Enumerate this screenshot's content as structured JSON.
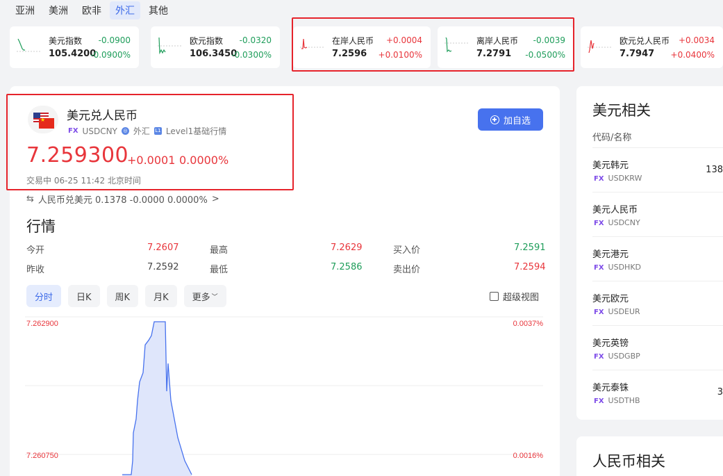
{
  "region_tabs": [
    "亚洲",
    "美洲",
    "欧非",
    "外汇",
    "其他"
  ],
  "active_region": "外汇",
  "tickers": [
    {
      "name": "美元指数",
      "price": "105.4200",
      "change": "-0.0900",
      "pct": "-0.0900%",
      "dir": "down"
    },
    {
      "name": "欧元指数",
      "price": "106.3450",
      "change": "-0.0320",
      "pct": "-0.0300%",
      "dir": "down"
    },
    {
      "name": "在岸人民币",
      "price": "7.2596",
      "change": "+0.0004",
      "pct": "+0.0100%",
      "dir": "up"
    },
    {
      "name": "离岸人民币",
      "price": "7.2791",
      "change": "-0.0039",
      "pct": "-0.0500%",
      "dir": "down"
    },
    {
      "name": "欧元兑人民币",
      "price": "7.7947",
      "change": "+0.0034",
      "pct": "+0.0400%",
      "dir": "up"
    }
  ],
  "instrument": {
    "title": "美元兑人民币",
    "fx_tag": "FX",
    "code": "USDCNY",
    "category": "外汇",
    "level_badge": "L1",
    "level": "Level1基础行情",
    "price": "7.259300",
    "change": "+0.0001",
    "change_pct": "0.0000%",
    "status": "交易中 06-25 11:42 北京时间",
    "add_button": "加自选",
    "inverse": "人民币兑美元 0.1378 -0.0000 0.0000%",
    "inverse_arrow": ">"
  },
  "market": {
    "title": "行情",
    "stats": [
      {
        "label": "今开",
        "value": "7.2607",
        "dir": "up"
      },
      {
        "label": "最高",
        "value": "7.2629",
        "dir": "up"
      },
      {
        "label": "买入价",
        "value": "7.2591",
        "dir": "down"
      },
      {
        "label": "昨收",
        "value": "7.2592",
        "dir": "flat"
      },
      {
        "label": "最低",
        "value": "7.2586",
        "dir": "down"
      },
      {
        "label": "卖出价",
        "value": "7.2594",
        "dir": "up"
      }
    ]
  },
  "period_tabs": [
    "分时",
    "日K",
    "周K",
    "月K",
    "更多"
  ],
  "active_period": "分时",
  "super_view": "超级视图",
  "chart_data": {
    "type": "area",
    "y_left_ticks": [
      "7.262900",
      "7.260750"
    ],
    "y_right_ticks": [
      "0.0037%",
      "0.0016%"
    ],
    "ylim": [
      7.2596,
      7.2629
    ],
    "x": [
      0,
      13,
      15,
      16,
      20,
      22,
      25,
      30,
      33,
      38,
      42,
      46,
      52,
      54,
      58,
      60,
      62,
      64,
      66,
      70,
      80,
      90,
      100
    ],
    "values": [
      7.2596,
      7.2596,
      7.2599,
      7.2605,
      7.2608,
      7.2612,
      7.2616,
      7.2618,
      7.2624,
      7.2625,
      7.2626,
      7.2629,
      7.2629,
      7.2629,
      7.2629,
      7.2629,
      7.2629,
      7.2614,
      7.262,
      7.2612,
      7.2604,
      7.2599,
      7.2596
    ],
    "grid": true
  },
  "usd_related": {
    "title": "美元相关",
    "column": "代码/名称",
    "items": [
      {
        "name": "美元韩元",
        "tag": "FX",
        "code": "USDKRW",
        "value": "138"
      },
      {
        "name": "美元人民币",
        "tag": "FX",
        "code": "USDCNY",
        "value": ""
      },
      {
        "name": "美元港元",
        "tag": "FX",
        "code": "USDHKD",
        "value": ""
      },
      {
        "name": "美元欧元",
        "tag": "FX",
        "code": "USDEUR",
        "value": ""
      },
      {
        "name": "美元英镑",
        "tag": "FX",
        "code": "USDGBP",
        "value": ""
      },
      {
        "name": "美元泰铢",
        "tag": "FX",
        "code": "USDTHB",
        "value": "3"
      }
    ]
  },
  "cny_related": {
    "title": "人民币相关"
  },
  "colors": {
    "up": "#e8353b",
    "down": "#1e9d5a",
    "accent": "#4772ee",
    "highlight_box": "#e6232b"
  }
}
